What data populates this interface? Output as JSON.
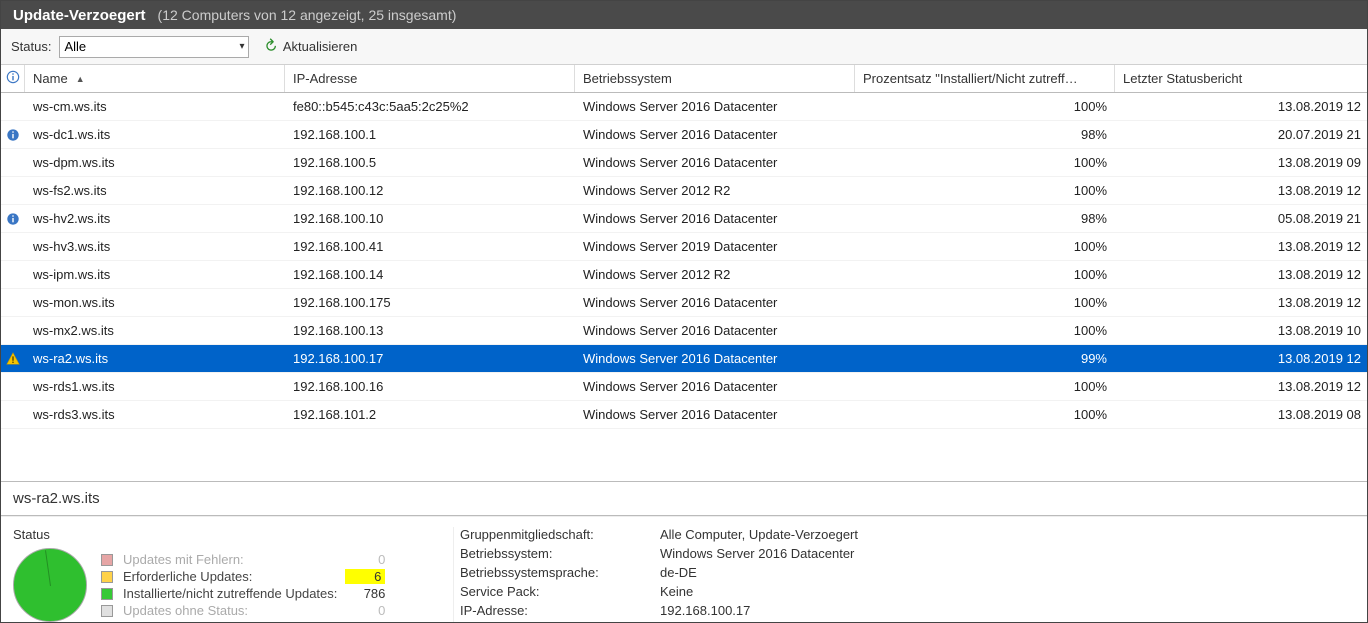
{
  "window": {
    "title": "Update-Verzoegert",
    "subtitle": "(12 Computers von 12 angezeigt, 25 insgesamt)"
  },
  "toolbar": {
    "status_label": "Status:",
    "status_value": "Alle",
    "refresh_label": "Aktualisieren"
  },
  "columns": {
    "name": "Name",
    "ip": "IP-Adresse",
    "os": "Betriebssystem",
    "pct": "Prozentsatz \"Installiert/Nicht zutreff…",
    "last": "Letzter Statusbericht"
  },
  "rows": [
    {
      "icon": "",
      "name": "ws-cm.ws.its",
      "ip": "fe80::b545:c43c:5aa5:2c25%2",
      "os": "Windows Server 2016 Datacenter",
      "pct": "100%",
      "last": "13.08.2019 12"
    },
    {
      "icon": "info",
      "name": "ws-dc1.ws.its",
      "ip": "192.168.100.1",
      "os": "Windows Server 2016 Datacenter",
      "pct": "98%",
      "last": "20.07.2019 21"
    },
    {
      "icon": "",
      "name": "ws-dpm.ws.its",
      "ip": "192.168.100.5",
      "os": "Windows Server 2016 Datacenter",
      "pct": "100%",
      "last": "13.08.2019 09"
    },
    {
      "icon": "",
      "name": "ws-fs2.ws.its",
      "ip": "192.168.100.12",
      "os": "Windows Server 2012 R2",
      "pct": "100%",
      "last": "13.08.2019 12"
    },
    {
      "icon": "info",
      "name": "ws-hv2.ws.its",
      "ip": "192.168.100.10",
      "os": "Windows Server 2016 Datacenter",
      "pct": "98%",
      "last": "05.08.2019 21"
    },
    {
      "icon": "",
      "name": "ws-hv3.ws.its",
      "ip": "192.168.100.41",
      "os": "Windows Server 2019 Datacenter",
      "pct": "100%",
      "last": "13.08.2019 12"
    },
    {
      "icon": "",
      "name": "ws-ipm.ws.its",
      "ip": "192.168.100.14",
      "os": "Windows Server 2012 R2",
      "pct": "100%",
      "last": "13.08.2019 12"
    },
    {
      "icon": "",
      "name": "ws-mon.ws.its",
      "ip": "192.168.100.175",
      "os": "Windows Server 2016 Datacenter",
      "pct": "100%",
      "last": "13.08.2019 12"
    },
    {
      "icon": "",
      "name": "ws-mx2.ws.its",
      "ip": "192.168.100.13",
      "os": "Windows Server 2016 Datacenter",
      "pct": "100%",
      "last": "13.08.2019 10"
    },
    {
      "icon": "warn",
      "name": "ws-ra2.ws.its",
      "ip": "192.168.100.17",
      "os": "Windows Server 2016 Datacenter",
      "pct": "99%",
      "last": "13.08.2019 12",
      "selected": true
    },
    {
      "icon": "",
      "name": "ws-rds1.ws.its",
      "ip": "192.168.100.16",
      "os": "Windows Server 2016 Datacenter",
      "pct": "100%",
      "last": "13.08.2019 12"
    },
    {
      "icon": "",
      "name": "ws-rds3.ws.its",
      "ip": "192.168.101.2",
      "os": "Windows Server 2016 Datacenter",
      "pct": "100%",
      "last": "13.08.2019 08"
    }
  ],
  "details": {
    "header": "ws-ra2.ws.its",
    "status_title": "Status",
    "legend": {
      "err_label": "Updates mit Fehlern:",
      "err_value": "0",
      "req_label": "Erforderliche Updates:",
      "req_value": "6",
      "inst_label": "Installierte/nicht zutreffende Updates:",
      "inst_value": "786",
      "none_label": "Updates ohne Status:",
      "none_value": "0"
    },
    "props": {
      "group_k": "Gruppenmitgliedschaft:",
      "group_v": "Alle Computer, Update-Verzoegert",
      "os_k": "Betriebssystem:",
      "os_v": "Windows Server 2016 Datacenter",
      "lang_k": "Betriebssystemsprache:",
      "lang_v": "de-DE",
      "sp_k": "Service Pack:",
      "sp_v": "Keine",
      "ip_k": "IP-Adresse:",
      "ip_v": "192.168.100.17"
    }
  }
}
